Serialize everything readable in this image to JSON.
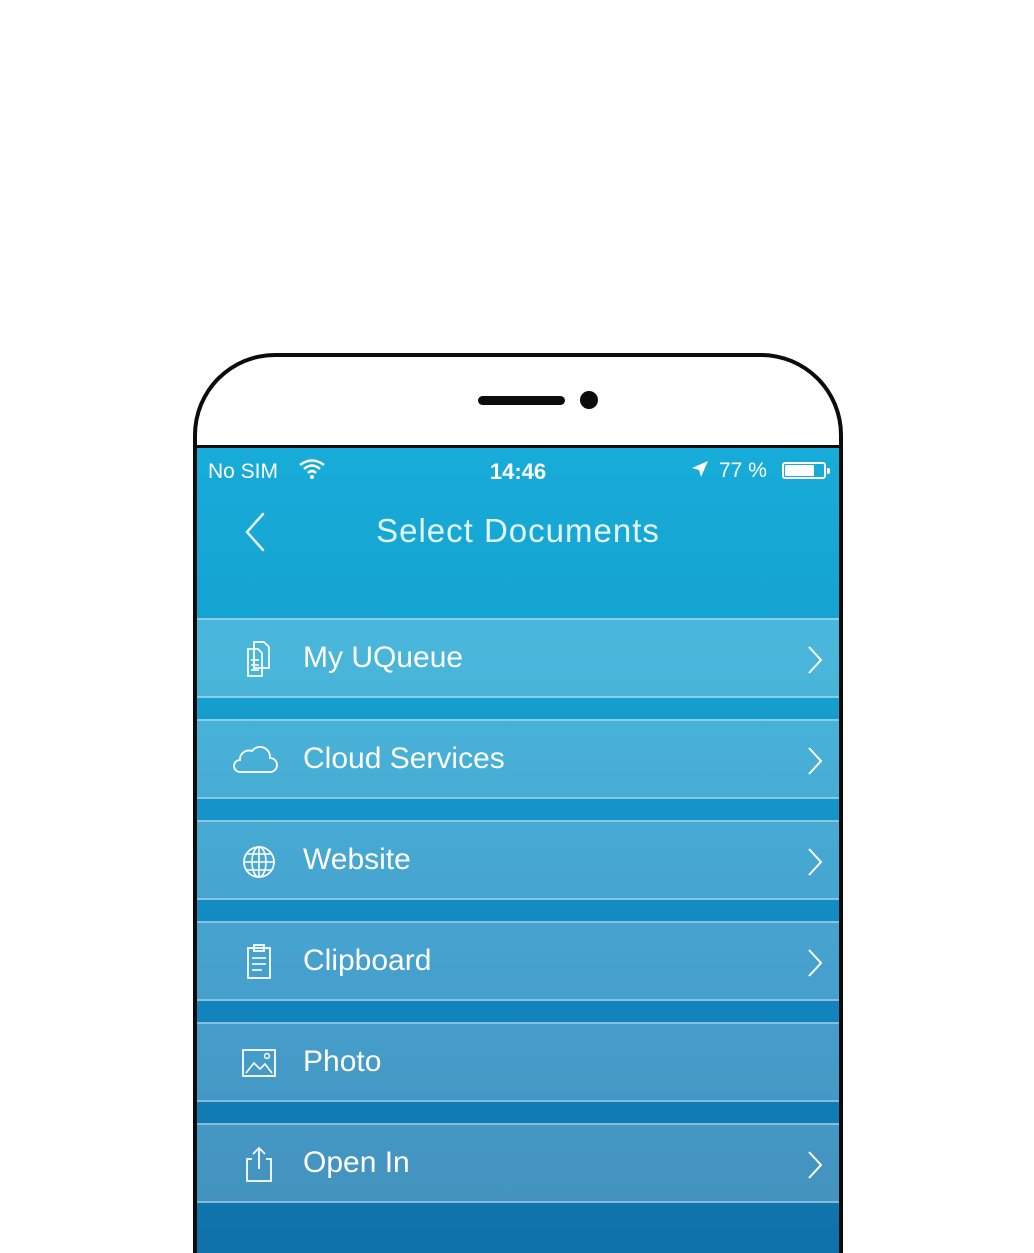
{
  "status_bar": {
    "carrier": "No SIM",
    "time": "14:46",
    "battery_percent": "77 %",
    "battery_level": 0.77
  },
  "nav": {
    "title": "Select Documents",
    "back_icon": "chevron-left-icon"
  },
  "menu": {
    "items": [
      {
        "label": "My UQueue",
        "icon": "documents-icon",
        "has_chevron": true
      },
      {
        "label": "Cloud Services",
        "icon": "cloud-icon",
        "has_chevron": true
      },
      {
        "label": "Website",
        "icon": "globe-icon",
        "has_chevron": true
      },
      {
        "label": "Clipboard",
        "icon": "clipboard-icon",
        "has_chevron": true
      },
      {
        "label": "Photo",
        "icon": "photo-icon",
        "has_chevron": false
      },
      {
        "label": "Open In",
        "icon": "share-icon",
        "has_chevron": true
      }
    ]
  },
  "colors": {
    "header": "#17acd9",
    "background_bottom": "#0f6fa8",
    "text": "#ffffff"
  }
}
